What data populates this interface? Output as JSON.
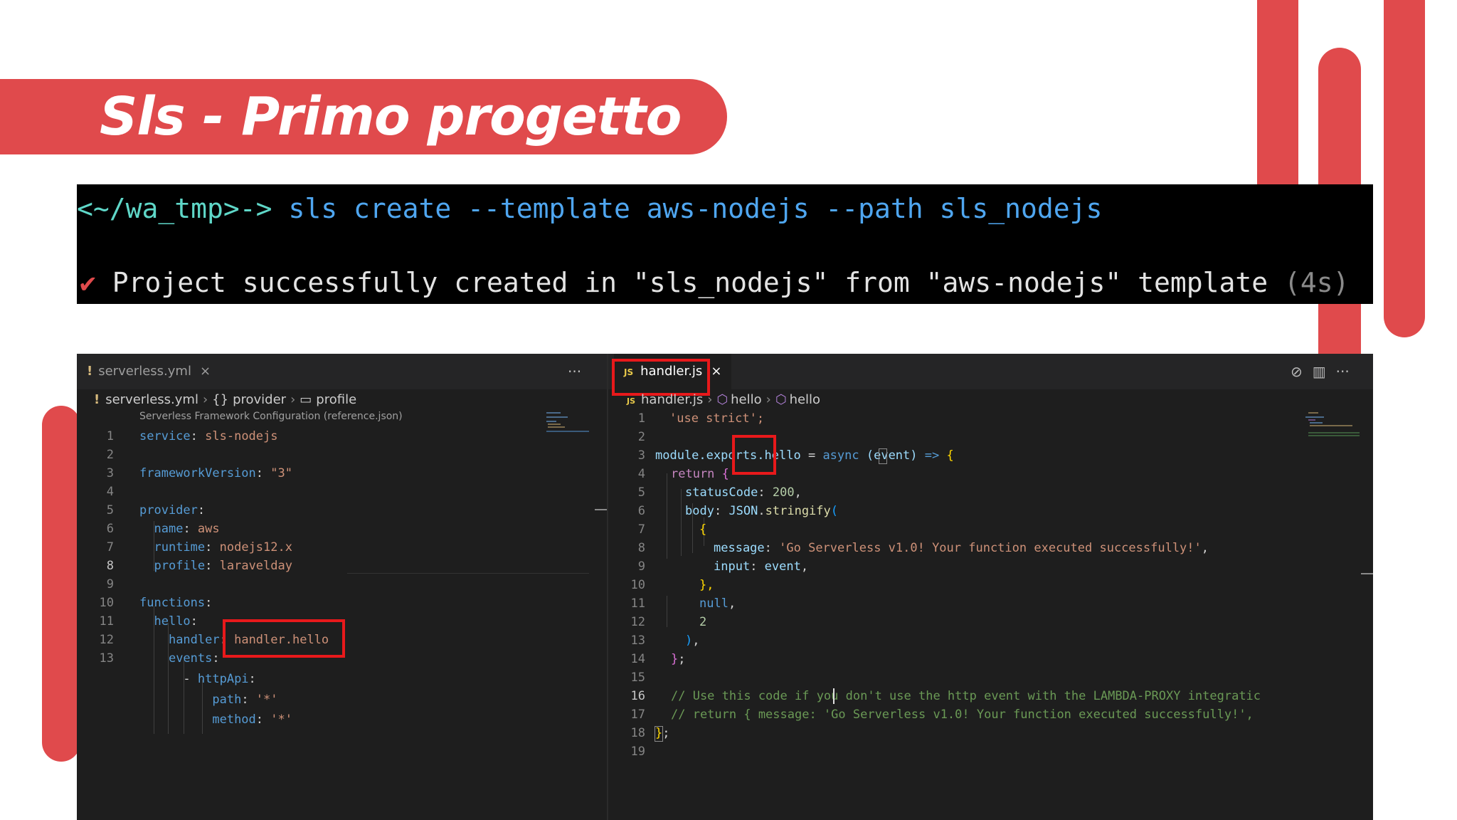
{
  "slide": {
    "title": "Sls - Primo progetto",
    "accent_color": "#e04a4c"
  },
  "terminal": {
    "prompt": "<~/wa_tmp>->",
    "command": "sls create --template aws-nodejs --path sls_nodejs",
    "check_icon": "checkmark-icon",
    "output": "Project successfully created in \"sls_nodejs\" from \"aws-nodejs\" template",
    "duration": "(4s)"
  },
  "left_pane": {
    "tab_label": "serverless.yml",
    "tab_close": "×",
    "more_actions": "···",
    "breadcrumb": [
      "serverless.yml",
      "provider",
      "profile"
    ],
    "schema_hint": "Serverless Framework Configuration (reference.json)",
    "lines": [
      {
        "n": "1",
        "t": "service: sls-nodejs"
      },
      {
        "n": "2",
        "t": ""
      },
      {
        "n": "3",
        "t": "frameworkVersion: \"3\""
      },
      {
        "n": "4",
        "t": ""
      },
      {
        "n": "5",
        "t": "provider:"
      },
      {
        "n": "6",
        "t": "  name: aws"
      },
      {
        "n": "7",
        "t": "  runtime: nodejs12.x"
      },
      {
        "n": "8",
        "t": "  profile: laravelday"
      },
      {
        "n": "9",
        "t": ""
      },
      {
        "n": "10",
        "t": "functions:"
      },
      {
        "n": "11",
        "t": "  hello:"
      },
      {
        "n": "12",
        "t": "    handler: handler.hello"
      },
      {
        "n": "13",
        "t": "    events:"
      },
      {
        "n": "",
        "t": "      - httpApi:"
      },
      {
        "n": "",
        "t": "          path: '*'"
      },
      {
        "n": "",
        "t": "          method: '*'"
      }
    ]
  },
  "right_pane": {
    "tab_label": "handler.js",
    "tab_close": "×",
    "actions": [
      "⊘",
      "▥",
      "···"
    ],
    "breadcrumb": [
      "handler.js",
      "hello",
      "hello"
    ],
    "lines": [
      {
        "n": "1"
      },
      {
        "n": "2"
      },
      {
        "n": "3"
      },
      {
        "n": "4"
      },
      {
        "n": "5"
      },
      {
        "n": "6"
      },
      {
        "n": "7"
      },
      {
        "n": "8"
      },
      {
        "n": "9"
      },
      {
        "n": "10"
      },
      {
        "n": "11"
      },
      {
        "n": "12"
      },
      {
        "n": "13"
      },
      {
        "n": "14"
      },
      {
        "n": "15"
      },
      {
        "n": "16"
      },
      {
        "n": "17"
      },
      {
        "n": "18"
      },
      {
        "n": "19"
      }
    ],
    "code": {
      "l1": "'use strict';",
      "l3_a": "module.exports",
      "l3_b": ".hello",
      "l3_c": " = ",
      "l3_d": "async",
      "l3_e": " (event) ",
      "l3_f": "=>",
      "l3_g": " {",
      "l4_a": "return",
      "l4_b": " {",
      "l5_a": "statusCode",
      "l5_b": ": ",
      "l5_c": "200",
      "l5_d": ",",
      "l6_a": "body",
      "l6_b": ": ",
      "l6_c": "JSON",
      "l6_d": ".",
      "l6_e": "stringify",
      "l6_f": "(",
      "l7": "{",
      "l8_a": "message",
      "l8_b": ": ",
      "l8_c": "'Go Serverless v1.0! Your function executed successfully!'",
      "l8_d": ",",
      "l9_a": "input",
      "l9_b": ": ",
      "l9_c": "event",
      "l9_d": ",",
      "l10": "},",
      "l11_a": "null",
      "l11_b": ",",
      "l12": "2",
      "l13_a": ")",
      "l13_b": ",",
      "l14_a": "}",
      "l14_b": ";",
      "l16": "// Use this code if you don't use the http event with the LAMBDA-PROXY integratic",
      "l17": "// return { message: 'Go Serverless v1.0! Your function executed successfully!',",
      "l18_a": "}",
      "l18_b": ";"
    }
  }
}
